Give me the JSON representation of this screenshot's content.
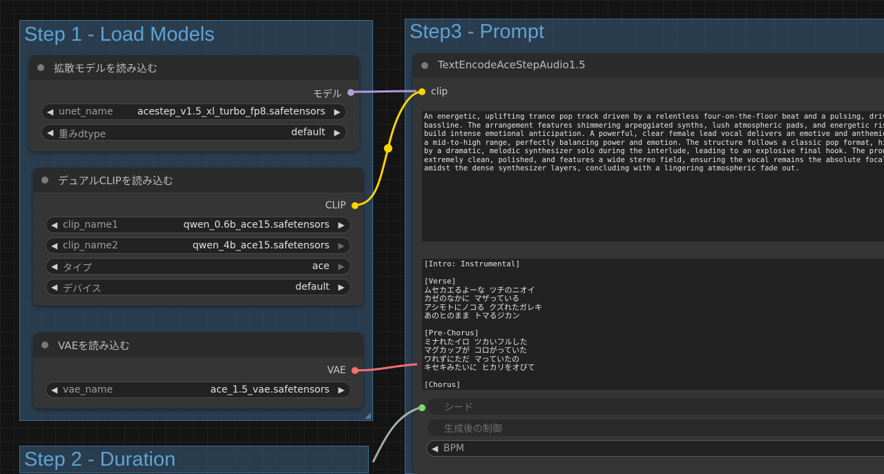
{
  "groups": {
    "step1": {
      "title": "Step 1 - Load Models"
    },
    "step2": {
      "title": "Step 2 - Duration"
    },
    "step3": {
      "title": "Step3 - Prompt"
    }
  },
  "diffusion_node": {
    "title": "拡散モデルを読み込む",
    "output_label": "モデル",
    "widgets": [
      {
        "label": "unet_name",
        "value": "acestep_v1.5_xl_turbo_fp8.safetensors"
      },
      {
        "label": "重みdtype",
        "value": "default"
      }
    ]
  },
  "clip_node": {
    "title": "デュアルCLIPを読み込む",
    "output_label": "CLIP",
    "widgets": [
      {
        "label": "clip_name1",
        "value": "qwen_0.6b_ace15.safetensors"
      },
      {
        "label": "clip_name2",
        "value": "qwen_4b_ace15.safetensors"
      },
      {
        "label": "タイプ",
        "value": "ace"
      },
      {
        "label": "デバイス",
        "value": "default"
      }
    ]
  },
  "vae_node": {
    "title": "VAEを読み込む",
    "output_label": "VAE",
    "widgets": [
      {
        "label": "vae_name",
        "value": "ace_1.5_vae.safetensors"
      }
    ]
  },
  "text_encode_node": {
    "title": "TextEncodeAceStepAudio1.5",
    "input_label": "clip",
    "prompt_text": "An energetic, uplifting trance pop track driven by a relentless four-on-the-floor beat and a pulsing, driv\nbassline. The arrangement features shimmering arpeggiated synths, lush atmospheric pads, and energetic ris\nbuild intense emotional anticipation. A powerful, clear female lead vocal delivers an emotive and anthemic\na mid-to-high range, perfectly balancing power and emotion. The structure follows a classic pop format, hi\nby a dramatic, melodic synthesizer solo during the interlude, leading to an explosive final hook. The prod\nextremely clean, polished, and features a wide stereo field, ensuring the vocal remains the absolute focal\namidst the dense synthesizer layers, concluding with a lingering atmospheric fade out.",
    "lyrics_text": "[Intro: Instrumental]\n\n[Verse]\nムセカエるよーな ツチのニオイ\nカゼのなかに マザっている\nアシモトにノコる クズれたガレキ\nあのヒのまま トマるジカン\n\n[Pre-Chorus]\nミナれたイロ ツカいフルした\nマグカップが コロがっていた\nワれずにただ マっていたの\nキセキみたいに ヒカリをオびて\n\n[Chorus]",
    "stub_widgets": [
      {
        "label": "シード"
      },
      {
        "label": "生成後の制御"
      }
    ],
    "bpm_label": "BPM"
  },
  "colors": {
    "canvas": "#141414",
    "group_fill": "#33516c",
    "group_title": "#5fa3d3",
    "node_body": "#353535",
    "node_header": "#2b2b2b",
    "model_port": "#b39ddb",
    "clip_port": "#ffd500",
    "vae_port": "#ff6e6e",
    "int_port": "#6ee66e",
    "widget_bg": "#222222"
  }
}
